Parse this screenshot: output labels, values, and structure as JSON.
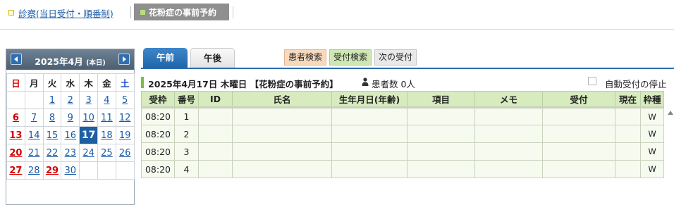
{
  "nav": {
    "shinsatsu_label": "診察(当日受付・順番制)",
    "kafun_label": "花粉症の事前予約"
  },
  "calendar": {
    "title": "2025年4月",
    "title_suffix": "(本日)",
    "weekdays": [
      "日",
      "月",
      "火",
      "水",
      "木",
      "金",
      "土"
    ],
    "weeks": [
      [
        "",
        "",
        "1",
        "2",
        "3",
        "4",
        "5"
      ],
      [
        "6",
        "7",
        "8",
        "9",
        "10",
        "11",
        "12"
      ],
      [
        "13",
        "14",
        "15",
        "16",
        "17",
        "18",
        "19"
      ],
      [
        "20",
        "21",
        "22",
        "23",
        "24",
        "25",
        "26"
      ],
      [
        "27",
        "28",
        "29",
        "30",
        "",
        "",
        ""
      ]
    ],
    "selected_day": "17",
    "holidays": [
      "29"
    ],
    "colors": {
      "sunday": "#d40000",
      "saturday": "#1743c9",
      "selected_bg": "#1e5ea3"
    }
  },
  "tabs": {
    "am_label": "午前",
    "pm_label": "午後"
  },
  "actions": {
    "patient_search": "患者検索",
    "reception_search": "受付検索",
    "next_reception": "次の受付"
  },
  "info": {
    "title": "2025年4月17日 木曜日 【花粉症の事前予約】",
    "patient_count": "患者数 0人",
    "auto_stop_label": "自動受付の停止"
  },
  "table": {
    "headers": [
      "受枠",
      "番号",
      "ID",
      "氏名",
      "生年月日(年齢)",
      "項目",
      "メモ",
      "受付",
      "現在",
      "枠種"
    ],
    "rows": [
      {
        "time": "08:20",
        "num": "1",
        "kind": "W"
      },
      {
        "time": "08:20",
        "num": "2",
        "kind": "W"
      },
      {
        "time": "08:20",
        "num": "3",
        "kind": "W"
      },
      {
        "time": "08:20",
        "num": "4",
        "kind": "W"
      }
    ]
  }
}
